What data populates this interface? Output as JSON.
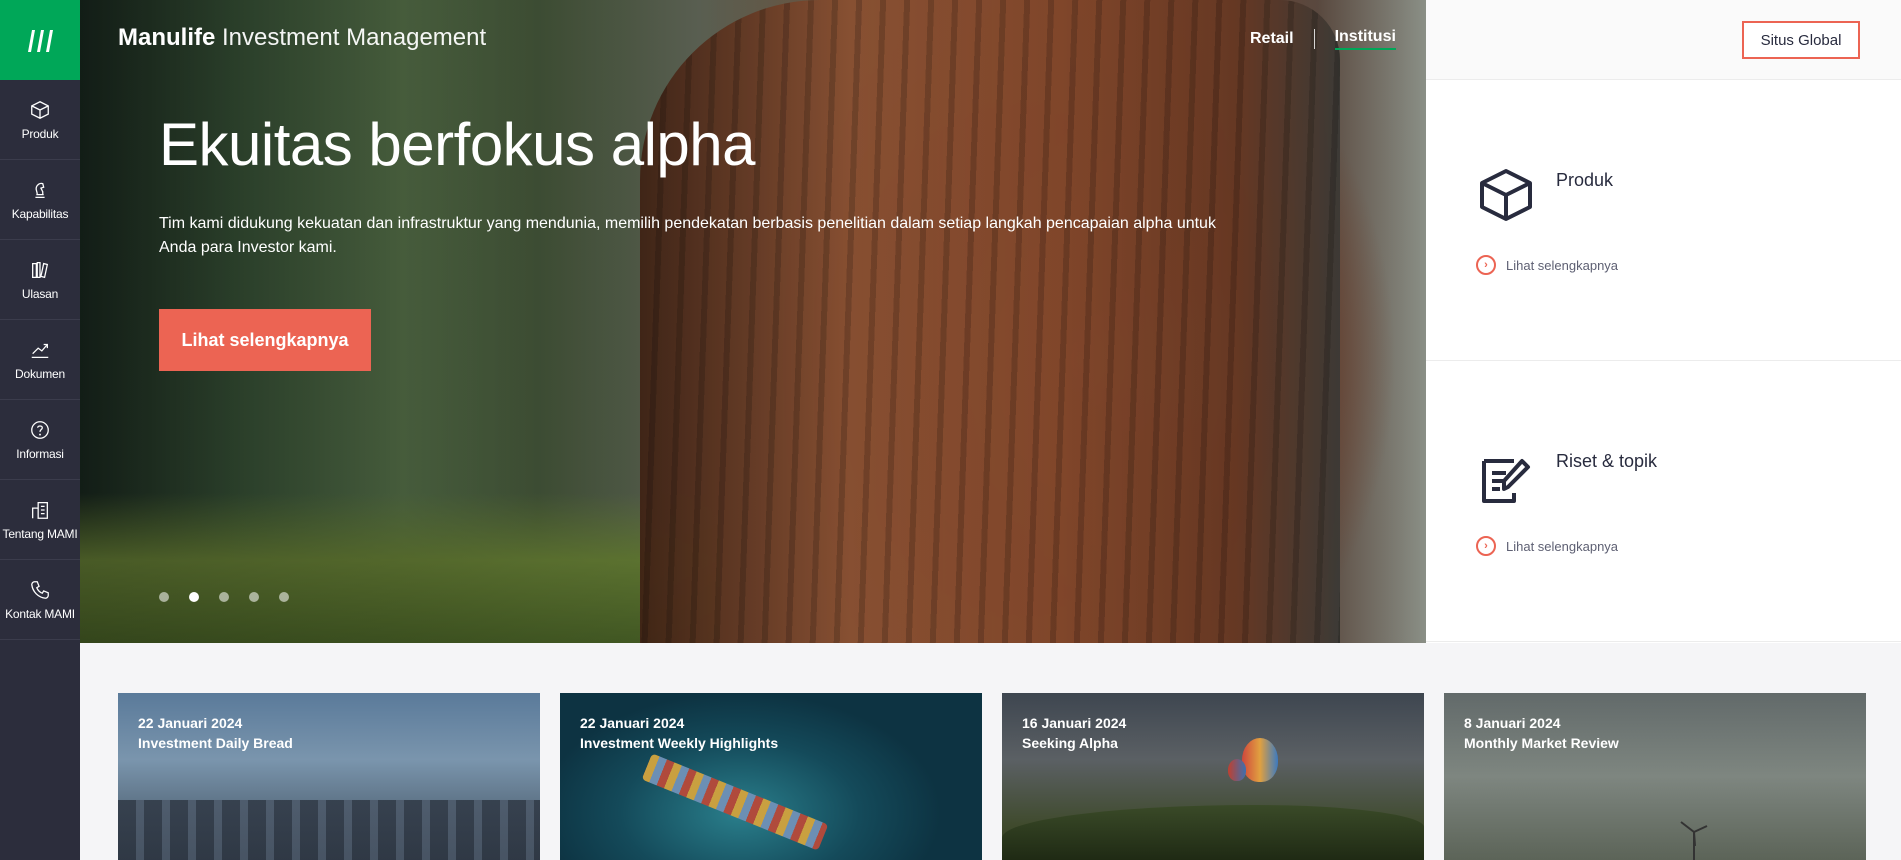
{
  "brand": {
    "name_bold": "Manulife",
    "name_light": "Investment Management"
  },
  "topnav": {
    "retail": "Retail",
    "institusi": "Institusi",
    "active": "Institusi"
  },
  "global_button": "Situs Global",
  "rail": [
    {
      "label": "Produk",
      "icon": "box-icon"
    },
    {
      "label": "Kapabilitas",
      "icon": "chess-knight-icon"
    },
    {
      "label": "Ulasan",
      "icon": "books-icon"
    },
    {
      "label": "Dokumen",
      "icon": "trend-line-icon"
    },
    {
      "label": "Informasi",
      "icon": "question-icon"
    },
    {
      "label": "Tentang MAMI",
      "icon": "building-icon"
    },
    {
      "label": "Kontak MAMI",
      "icon": "phone-icon"
    }
  ],
  "hero": {
    "title": "Ekuitas berfokus alpha",
    "text": "Tim kami didukung kekuatan dan infrastruktur yang mendunia, memilih pendekatan berbasis penelitian dalam setiap langkah pencapaian alpha untuk Anda para Investor kami.",
    "button": "Lihat selengkapnya",
    "slides": 5,
    "active_slide": 2
  },
  "cards": [
    {
      "title": "Produk",
      "link": "Lihat selengkapnya",
      "icon": "box-icon"
    },
    {
      "title": "Riset & topik",
      "link": "Lihat selengkapnya",
      "icon": "document-edit-icon"
    }
  ],
  "news": [
    {
      "date": "22 Januari 2024",
      "title": "Investment Daily Bread"
    },
    {
      "date": "22 Januari 2024",
      "title": "Investment Weekly Highlights"
    },
    {
      "date": "16 Januari 2024",
      "title": "Seeking Alpha"
    },
    {
      "date": "8 Januari 2024",
      "title": "Monthly Market Review"
    }
  ],
  "colors": {
    "accent": "#ec6453",
    "green": "#00a758",
    "rail": "#2c2d3c",
    "ink": "#282b3e"
  }
}
